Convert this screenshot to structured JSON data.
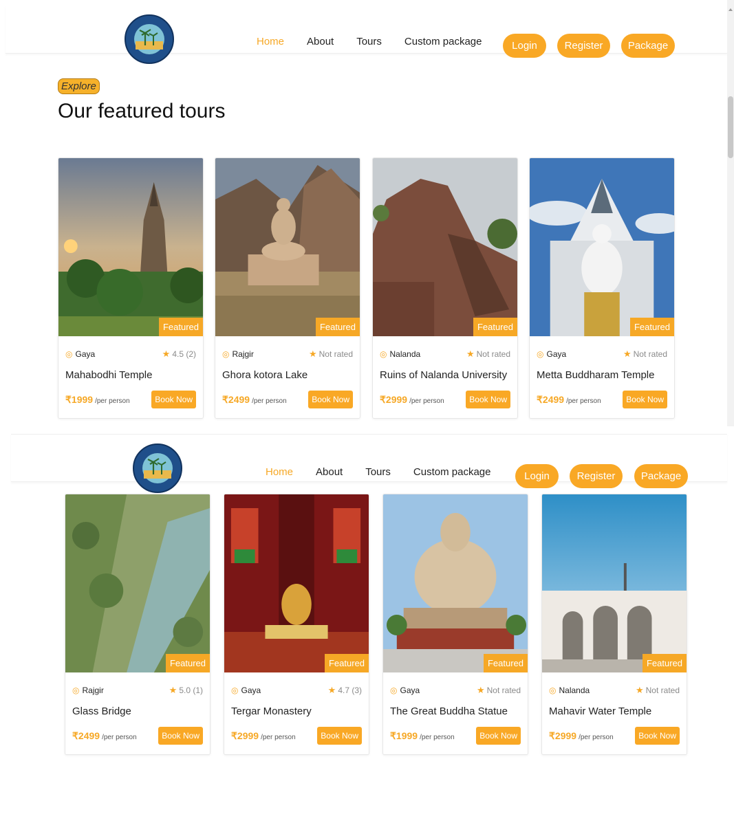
{
  "nav": {
    "logo_text": "BIHAR SAIR · BLISSFUL BIHAR",
    "menu": [
      "Home",
      "About",
      "Tours",
      "Custom package"
    ],
    "login": "Login",
    "register": "Register",
    "package": "Package"
  },
  "section": {
    "tag": "Explore",
    "title": "Our featured tours"
  },
  "featured_badge": "Featured",
  "book_label": "Book Now",
  "per_person": "/per person",
  "tours": [
    {
      "location": "Gaya",
      "rating": "4.5 (2)",
      "name": "Mahabodhi Temple",
      "price": "₹1999"
    },
    {
      "location": "Rajgir",
      "rating": "Not rated",
      "name": "Ghora kotora Lake",
      "price": "₹2499"
    },
    {
      "location": "Nalanda",
      "rating": "Not rated",
      "name": "Ruins of Nalanda University",
      "price": "₹2999"
    },
    {
      "location": "Gaya",
      "rating": "Not rated",
      "name": "Metta Buddharam Temple",
      "price": "₹2499"
    },
    {
      "location": "Rajgir",
      "rating": "5.0 (1)",
      "name": "Glass Bridge",
      "price": "₹2499"
    },
    {
      "location": "Gaya",
      "rating": "4.7 (3)",
      "name": "Tergar Monastery",
      "price": "₹2999"
    },
    {
      "location": "Gaya",
      "rating": "Not rated",
      "name": "The Great Buddha Statue",
      "price": "₹1999"
    },
    {
      "location": "Nalanda",
      "rating": "Not rated",
      "name": "Mahavir Water Temple",
      "price": "₹2999"
    }
  ],
  "colors": {
    "accent": "#f6a826",
    "button": "#f9a825",
    "logo_blue": "#1f4f8a"
  }
}
